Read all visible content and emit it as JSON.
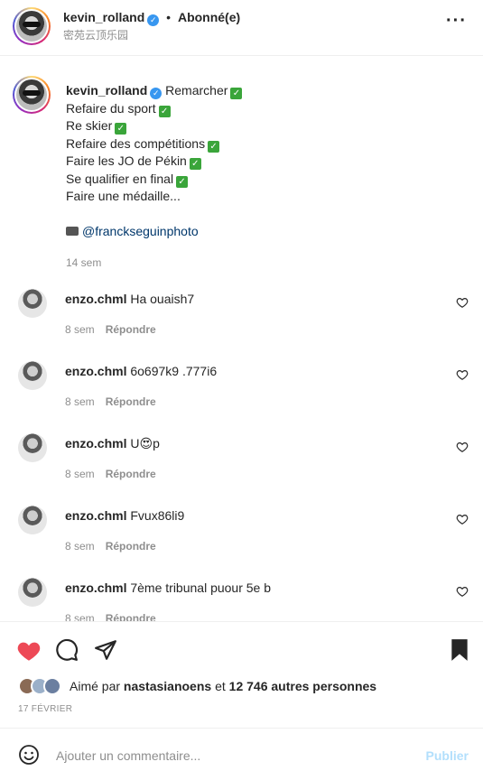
{
  "header": {
    "username": "kevin_rolland",
    "separator": "•",
    "follow_status": "Abonné(e)",
    "location": "密苑云顶乐园",
    "more_label": "···"
  },
  "caption": {
    "username": "kevin_rolland",
    "lines": [
      "Remarcher",
      "Refaire du sport",
      "Re skier",
      "Refaire des compétitions",
      "Faire les JO de Pékin",
      "Se qualifier en final",
      "Faire une médaille..."
    ],
    "mention": "@franckseguinphoto",
    "time": "14 sem"
  },
  "comments": [
    {
      "username": "enzo.chml",
      "text": "Ha ouaish7",
      "time": "8 sem",
      "reply": "Répondre"
    },
    {
      "username": "enzo.chml",
      "text": "6o697k9 .777i6",
      "time": "8 sem",
      "reply": "Répondre"
    },
    {
      "username": "enzo.chml",
      "text": "U😍p",
      "time": "8 sem",
      "reply": "Répondre"
    },
    {
      "username": "enzo.chml",
      "text": "Fvux86li9",
      "time": "8 sem",
      "reply": "Répondre"
    },
    {
      "username": "enzo.chml",
      "text": "7ème tribunal puour 5e b",
      "time": "8 sem",
      "reply": "Répondre"
    }
  ],
  "likes": {
    "prefix": "Aimé par",
    "user": "nastasianoens",
    "middle": "et",
    "others": "12 746 autres personnes"
  },
  "date": "17 FÉVRIER",
  "add_comment": {
    "placeholder": "Ajouter un commentaire...",
    "publish": "Publier"
  },
  "colors": {
    "like_red": "#ed4956",
    "verified_blue": "#3897f0",
    "mention": "#00376b",
    "publish_disabled": "#b2dffc"
  }
}
